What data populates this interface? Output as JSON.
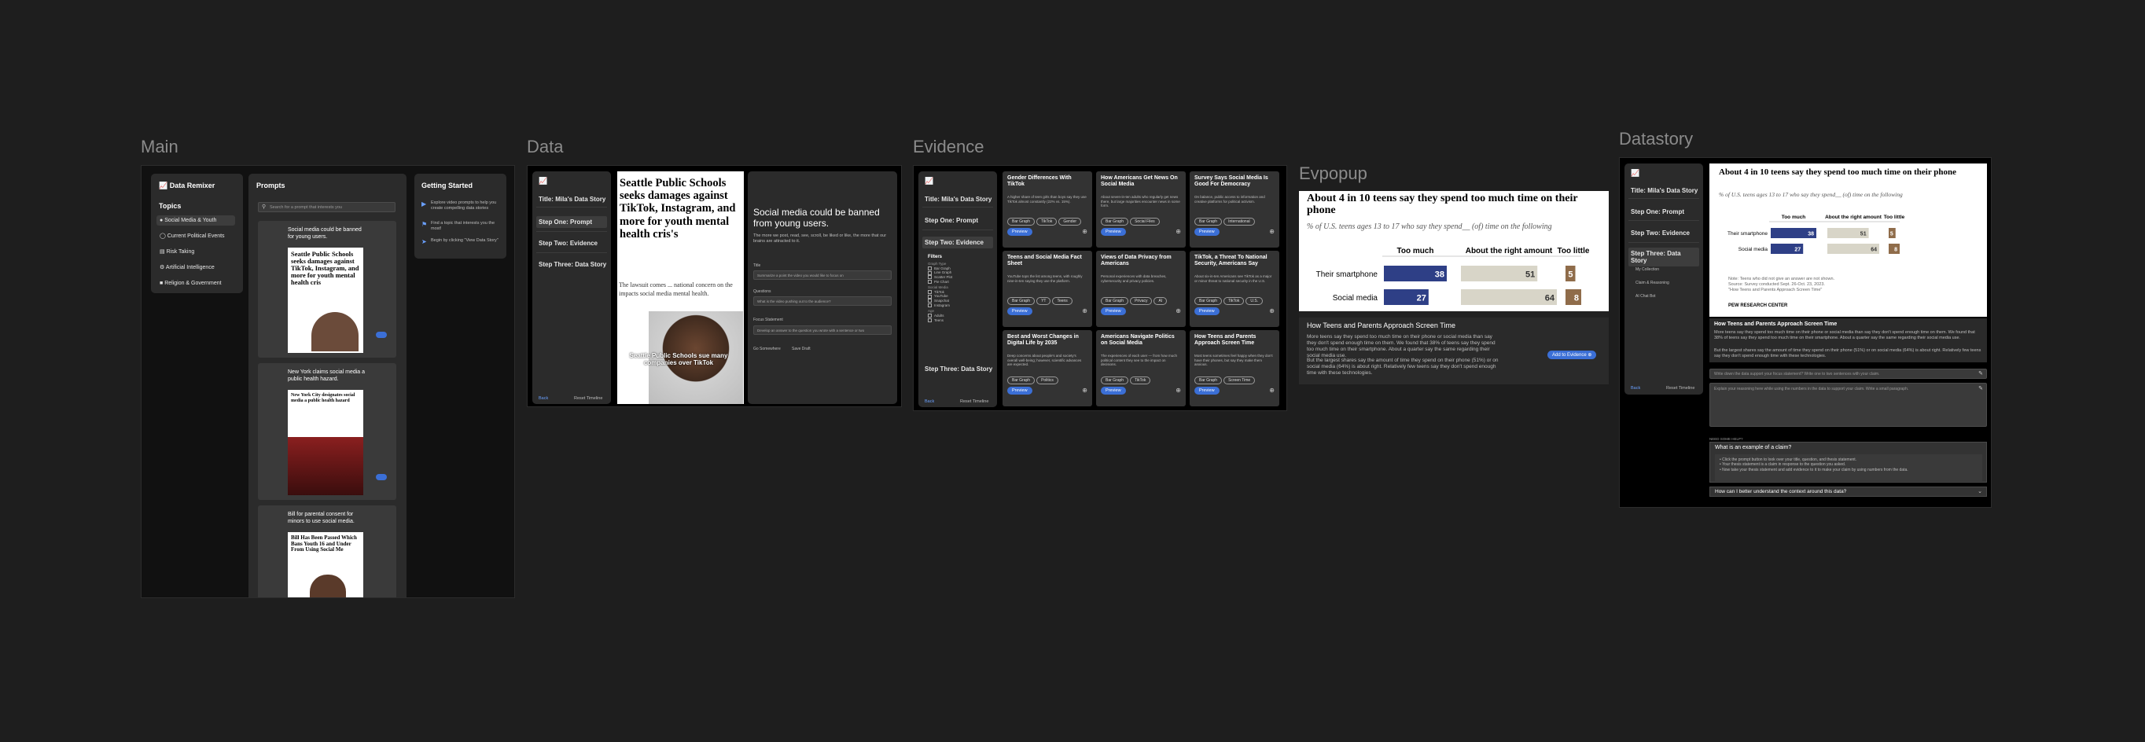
{
  "frames": {
    "main": "Main",
    "data": "Data",
    "evidence": "Evidence",
    "evpopup": "Evpopup",
    "datastory": "Datastory"
  },
  "main": {
    "logo": "Data Remixer",
    "topics_title": "Topics",
    "topics": [
      "Social Media & Youth",
      "Current Political Events",
      "Risk Taking",
      "Artificial Intelligence",
      "Religion & Government"
    ],
    "prompts_title": "Prompts",
    "search_placeholder": "Search for a prompt that interests you",
    "prompts": [
      {
        "title": "Social media could be banned for young users.",
        "img_headline": "Seattle Public Schools seeks damages against TikTok, Instagram, and more for youth mental health cris"
      },
      {
        "title": "New York claims social media a public health hazard.",
        "img_headline": "New York City designates social media a public health hazard"
      },
      {
        "title": "Bill for parental consent for minors to use social media.",
        "img_headline": "Bill Has Been Passed Which Bans Youth 16 and Under From Using Social Me"
      }
    ],
    "getting_started_title": "Getting Started",
    "getting_started": [
      "Explore video prompts to help you create compelling data stories",
      "Find a topic that interests you the most!",
      "Begin by clicking \"View Data Story\""
    ]
  },
  "data": {
    "title": "Title: Mila's Data Story",
    "steps": [
      "Step One: Prompt",
      "Step Two: Evidence",
      "Step Three: Data Story"
    ],
    "footer_left": "Back",
    "footer_right": "Reset Timeline",
    "video_headline": "Seattle Public Schools seeks damages against TikTok, Instagram, and more for youth mental health cris's",
    "video_body": "The lawsuit comes ... national concern on the impacts social media mental health.",
    "video_caption": "Seattle Public Schools sue many companies over TikTok",
    "prompt_heading": "Social media could be banned from young users.",
    "prompt_body": "The more we post, read, see, scroll, be liked or like, the more that our brains are attracted to it.",
    "q1_label": "Title",
    "q1_placeholder": "Summarize a point the video you would like to focus on",
    "q2_label": "Questions",
    "q2_placeholder": "What is the video pushing out to the audience?",
    "q3_label": "Focus Statement",
    "q3_placeholder": "Develop an answer to the question you wrote with a sentence or two",
    "actions": [
      "Go Somewhere",
      "Save Draft"
    ]
  },
  "evidence": {
    "title": "Title: Mila's Data Story",
    "steps": [
      "Step One: Prompt",
      "Step Two: Evidence",
      "Step Three: Data Story"
    ],
    "filters_title": "Filters",
    "filter_groups": [
      {
        "name": "Graph Type",
        "items": [
          "Bar Graph",
          "Line Graph",
          "Scatter Plot",
          "Pie Chart"
        ]
      },
      {
        "name": "Social Media",
        "items": [
          "TikTok",
          "YouTube",
          "Snapchat",
          "Instagram"
        ]
      },
      {
        "name": "Age",
        "items": [
          "Adults",
          "Teens"
        ]
      }
    ],
    "footer_left": "Back",
    "footer_right": "Reset Timeline",
    "cards": [
      {
        "title": "Gender Differences With TikTok",
        "body": "A higher share of teen girls than boys say they use TikTok almost constantly (22% vs. 15%).",
        "tags": [
          "Bar Graph",
          "TikTok",
          "Gender"
        ]
      },
      {
        "title": "How Americans Get News On Social Media",
        "body": "About seven-in-ten adults who regularly get news there, but large majorities encounter news in some form.",
        "tags": [
          "Bar Graph",
          "Social Files"
        ]
      },
      {
        "title": "Survey Says Social Media Is Good For Democracy",
        "body": "On balance, public access to information and creative platforms for political activism.",
        "tags": [
          "Bar Graph",
          "International"
        ]
      },
      {
        "title": "Teens and Social Media Fact Sheet",
        "body": "YouTube tops the list among teens, with roughly nine-in-ten saying they use the platform.",
        "tags": [
          "Bar Graph",
          "YT",
          "Teens"
        ]
      },
      {
        "title": "Views of Data Privacy from Americans",
        "body": "Personal experiences with data breaches, cybersecurity and privacy policies.",
        "tags": [
          "Bar Graph",
          "Privacy",
          "AI"
        ]
      },
      {
        "title": "TikTok, a Threat To National Security, Americans Say",
        "body": "About six-in-ten Americans see TikTok as a major or minor threat to national security in the U.S.",
        "tags": [
          "Bar Graph",
          "TikTok",
          "U.S."
        ]
      },
      {
        "title": "Best and Worst Changes in Digital Life by 2035",
        "body": "Deep concerns about people's and society's overall well-being; however, scientific advances are expected.",
        "tags": [
          "Bar Graph",
          "Politics"
        ]
      },
      {
        "title": "Americans Navigate Politics on Social Media",
        "body": "The experiences of each user — from how much political content they see to the impact on decisions.",
        "tags": [
          "Bar Graph",
          "TikTok"
        ]
      },
      {
        "title": "How Teens and Parents Approach Screen Time",
        "body": "Most teens sometimes feel happy when they don't have their phones, but say they make them anxious.",
        "tags": [
          "Bar Graph",
          "Screen Time"
        ]
      }
    ],
    "card_button": "Preview"
  },
  "popup": {
    "chart_title": "About 4 in 10 teens say they spend too much time on their phone",
    "chart_subtitle": "% of U.S. teens ages 13 to 17 who say they spend__ (of) time on the following",
    "caption_title": "How Teens and Parents Approach Screen Time",
    "caption_body": "More teens say they spend too much time on their phone or social media than say they don't spend enough time on them. We found that 38% of teens say they spend too much time on their smartphone. About a quarter say the same regarding their social media use.",
    "caption_body2": "But the largest shares say the amount of time they spend on their phone (51%) or on social media (64%) is about right. Relatively few teens say they don't spend enough time with these technologies.",
    "add_button": "Add to Evidence"
  },
  "chart_data": {
    "type": "bar",
    "title": "About 4 in 10 teens say they spend too much time on their phone",
    "subtitle": "% of U.S. teens ages 13 to 17 who say they spend__ (of) time on the following",
    "categories": [
      "Their smartphone",
      "Social media"
    ],
    "series": [
      {
        "name": "Too much",
        "values": [
          38,
          27
        ],
        "color": "#2e3f86"
      },
      {
        "name": "About the right amount",
        "values": [
          51,
          64
        ],
        "color": "#d8d5c8"
      },
      {
        "name": "Too little",
        "values": [
          5,
          8
        ],
        "color": "#8f6c4a"
      }
    ],
    "stacked": false
  },
  "datastory": {
    "title": "Title: Mila's Data Story",
    "steps": [
      "Step One: Prompt",
      "Step Two: Evidence",
      "Step Three: Data Story"
    ],
    "sub_steps": [
      "My Collection",
      "Claim & Reasoning",
      "AI Chat Bot"
    ],
    "footer_left": "Back",
    "footer_right": "Reset Timeline",
    "chart_notes": [
      "Note: Teens who did not give an answer are not shown.",
      "Source: Survey conducted Sept. 26-Oct. 23, 2023.",
      "\"How Teens and Parents Approach Screen Time\""
    ],
    "source": "PEW RESEARCH CENTER",
    "caption_title": "How Teens and Parents Approach Screen Time",
    "caption_body": "More teens say they spend too much time on their phone or social media than say they don't spend enough time on them. We found that 38% of teens say they spend too much time on their smartphone. About a quarter say the same regarding their social media use.",
    "caption_body2": "But the largest shares say the amount of time they spend on their phone (51%) or on social media (64%) is about right. Relatively few teens say they don't spend enough time with these technologies.",
    "claim_placeholder": "Write down the data support your focus statement? Write one to two sentences with your claim.",
    "reasoning_placeholder": "Explain your reasoning here while using the numbers in the data to support your claim. Write a small paragraph.",
    "help_label": "NEED SOME HELP?",
    "faq1_q": "What is an example of a claim?",
    "faq1_items": [
      "Click the prompt button to look over your title, question, and thesis statement.",
      "Your thesis statement is a claim in response to the question you asked.",
      "Now take your thesis statement and add evidence to it to make your claim by using numbers from the data."
    ],
    "faq2_q": "How can I better understand the context around this data?"
  }
}
